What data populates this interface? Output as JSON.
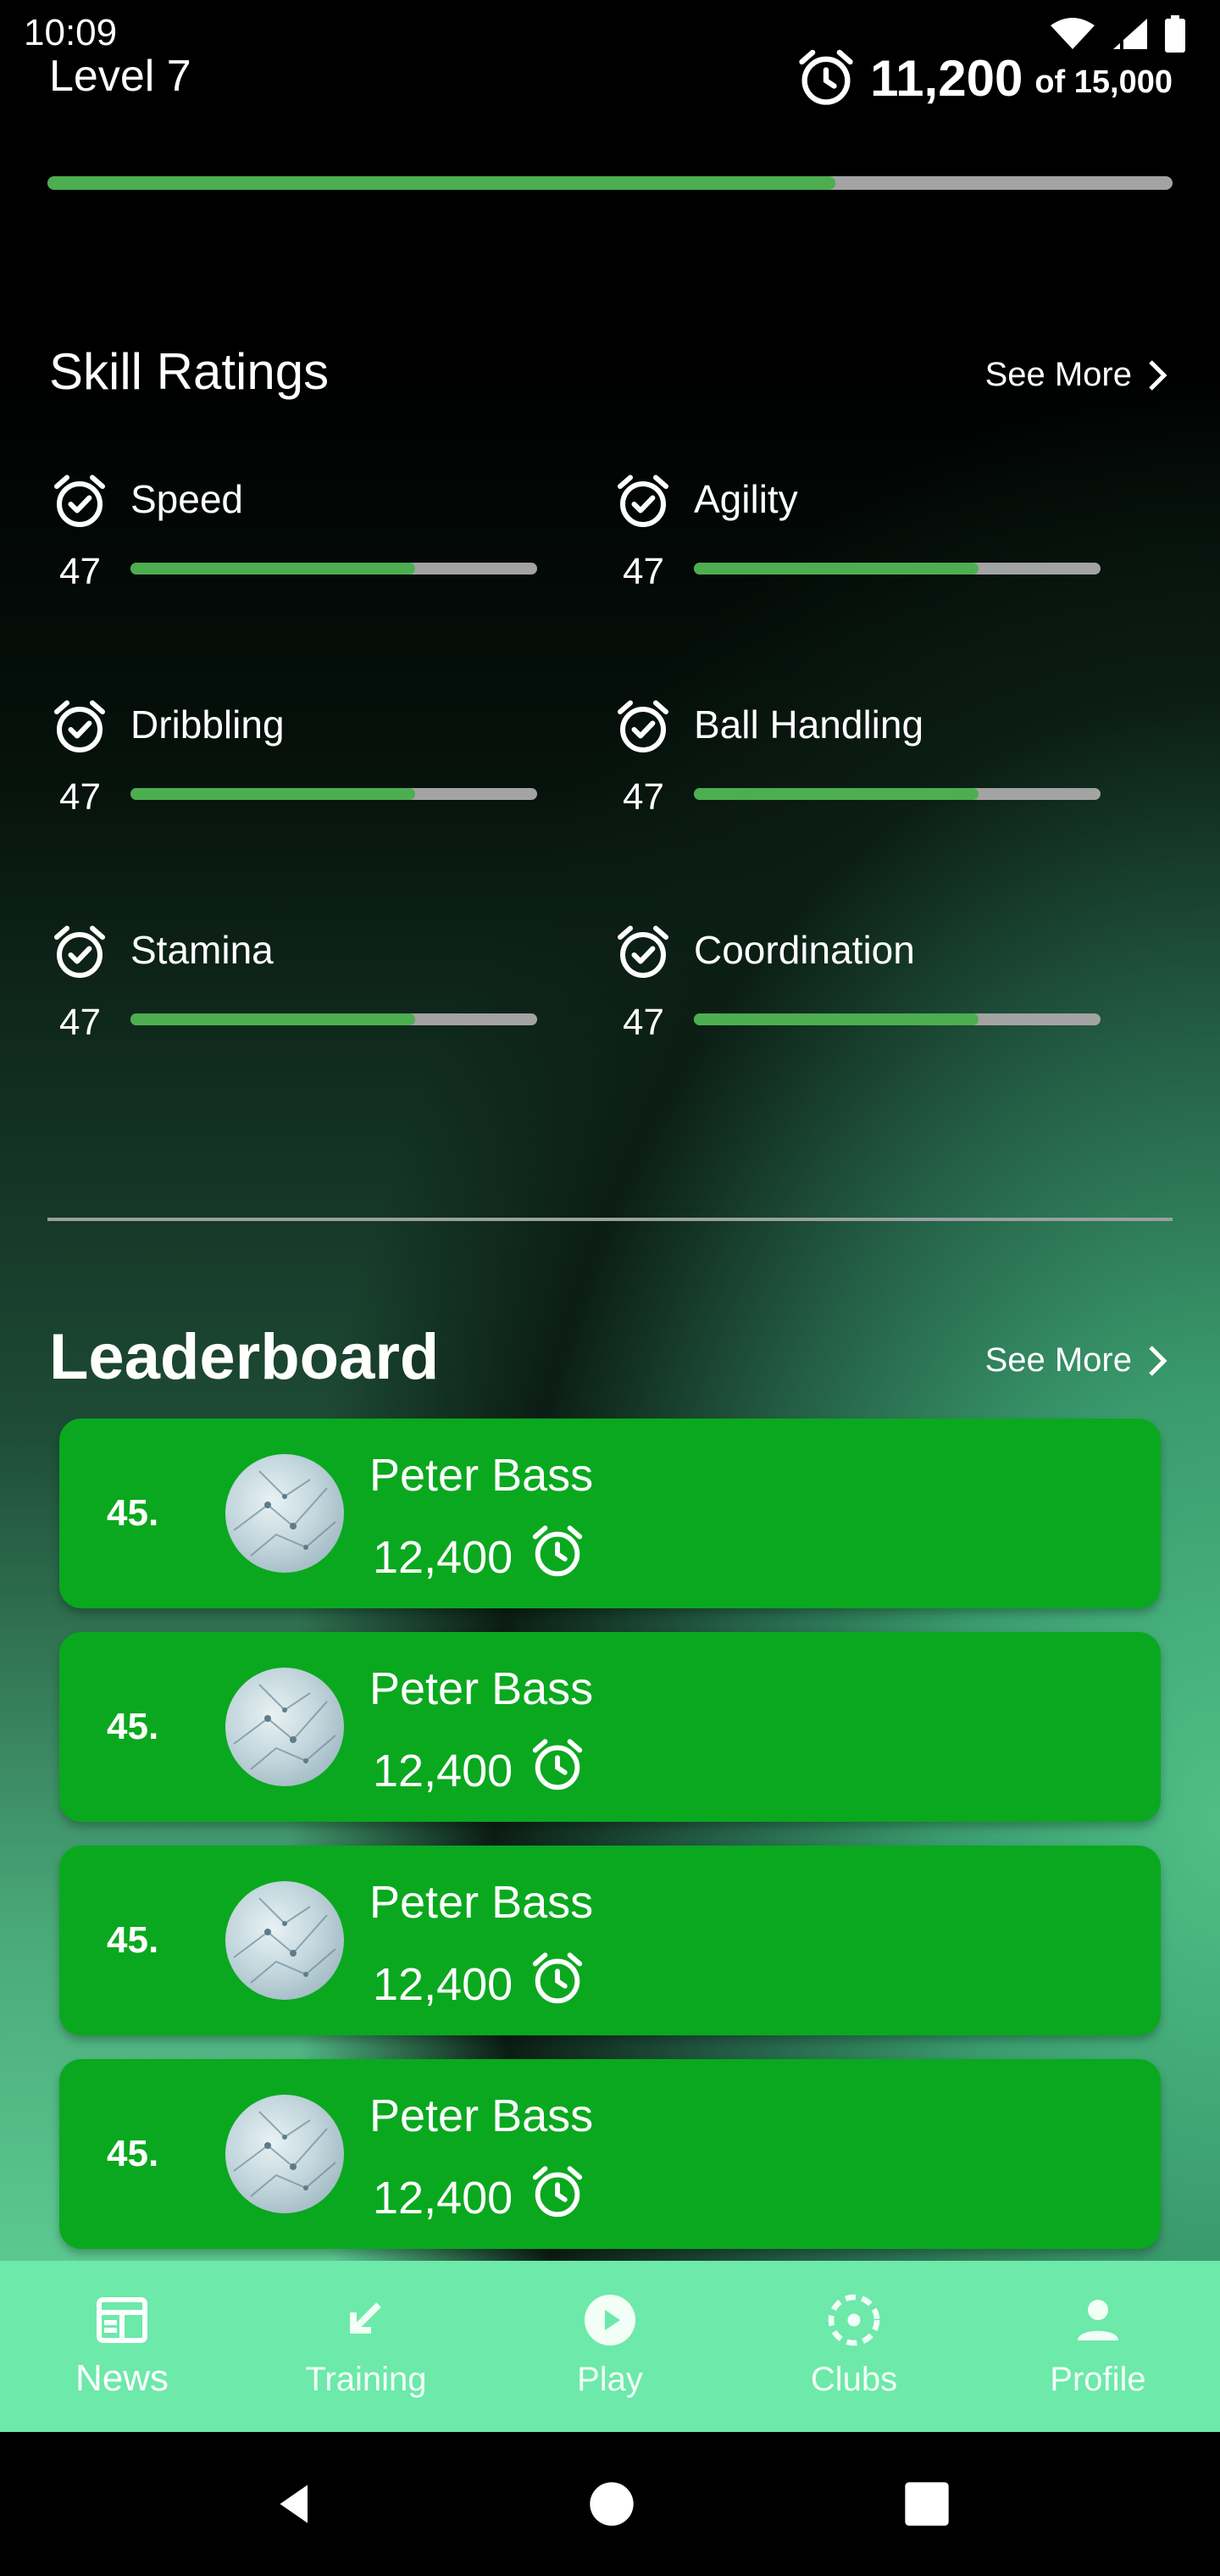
{
  "status_bar": {
    "time": "10:09",
    "icons": [
      "wifi-icon",
      "signal-icon",
      "battery-icon"
    ]
  },
  "header": {
    "level": "Level 7",
    "xp_current": "11,200",
    "xp_total": "of 15,000",
    "xp_progress": 0.7,
    "icon": "alarm-clock-icon"
  },
  "skills": {
    "title": "Skill Ratings",
    "see_more": "See More",
    "items": [
      {
        "name": "Speed",
        "value": "47",
        "progress": 0.7
      },
      {
        "name": "Agility",
        "value": "47",
        "progress": 0.7
      },
      {
        "name": "Dribbling",
        "value": "47",
        "progress": 0.7
      },
      {
        "name": "Ball Handling",
        "value": "47",
        "progress": 0.7
      },
      {
        "name": "Stamina",
        "value": "47",
        "progress": 0.7
      },
      {
        "name": "Coordination",
        "value": "47",
        "progress": 0.7
      }
    ]
  },
  "leaderboard": {
    "title": "Leaderboard",
    "see_more": "See More",
    "entries": [
      {
        "rank": "45.",
        "name": "Peter Bass",
        "score": "12,400"
      },
      {
        "rank": "45.",
        "name": "Peter Bass",
        "score": "12,400"
      },
      {
        "rank": "45.",
        "name": "Peter Bass",
        "score": "12,400"
      },
      {
        "rank": "45.",
        "name": "Peter Bass",
        "score": "12,400"
      }
    ]
  },
  "bottom_nav": {
    "active": "News",
    "items": [
      {
        "label": "News",
        "icon": "newspaper-icon"
      },
      {
        "label": "Training",
        "icon": "arrow-down-left-icon"
      },
      {
        "label": "Play",
        "icon": "play-icon"
      },
      {
        "label": "Clubs",
        "icon": "clubs-icon"
      },
      {
        "label": "Profile",
        "icon": "person-icon"
      }
    ]
  },
  "colors": {
    "accent_green": "#4cae4f",
    "card_green": "#0aa81f",
    "nav_green": "#6de9aa",
    "track_grey": "#a3a3a3"
  }
}
